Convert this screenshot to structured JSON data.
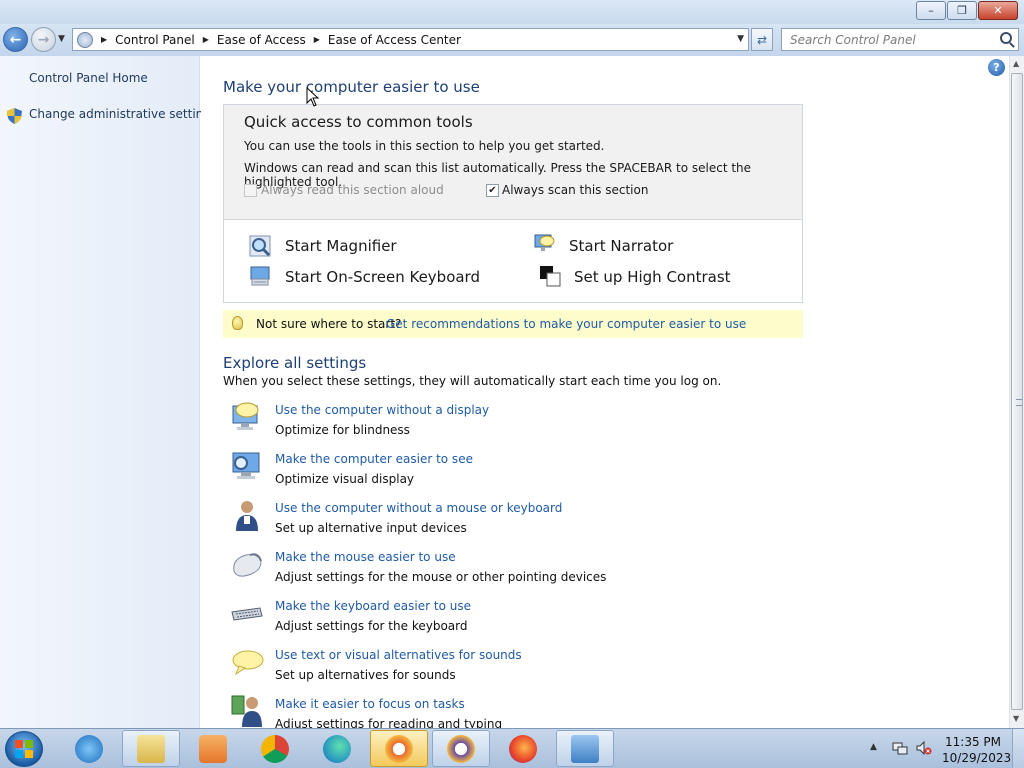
{
  "window": {
    "controls": {
      "minimize_icon": "minimize-icon",
      "maximize_icon": "restore-icon",
      "close_icon": "close-icon"
    }
  },
  "address_bar": {
    "breadcrumbs": [
      "Control Panel",
      "Ease of Access",
      "Ease of Access Center"
    ],
    "search_placeholder": "Search Control Panel"
  },
  "sidebar": {
    "items": [
      {
        "label": "Control Panel Home",
        "icon": ""
      },
      {
        "label": "Change administrative settings",
        "icon": "uac-shield-icon"
      }
    ]
  },
  "main": {
    "heading": "Make your computer easier to use",
    "quick_access": {
      "title": "Quick access to common tools",
      "line1": "You can use the tools in this section to help you get started.",
      "line2": "Windows can read and scan this list automatically.  Press the SPACEBAR to select the highlighted tool.",
      "read_aloud": {
        "label": "Always read this section aloud",
        "checked": false,
        "enabled": false
      },
      "scan": {
        "label": "Always scan this section",
        "checked": true,
        "enabled": true
      },
      "tools": [
        {
          "label": "Start Magnifier",
          "icon": "magnifier-icon"
        },
        {
          "label": "Start Narrator",
          "icon": "narrator-icon"
        },
        {
          "label": "Start On-Screen Keyboard",
          "icon": "onscreen-keyboard-icon"
        },
        {
          "label": "Set up High Contrast",
          "icon": "high-contrast-icon"
        }
      ]
    },
    "tip": {
      "prefix": "Not sure where to start?",
      "link": "Get recommendations to make your computer easier to use"
    },
    "explore": {
      "heading": "Explore all settings",
      "subtitle": "When you select these settings, they will automatically start each time you log on.",
      "items": [
        {
          "link": "Use the computer without a display",
          "desc": "Optimize for blindness",
          "icon": "display-speech-icon"
        },
        {
          "link": "Make the computer easier to see",
          "desc": "Optimize visual display",
          "icon": "monitor-magnify-icon"
        },
        {
          "link": "Use the computer without a mouse or keyboard",
          "desc": "Set up alternative input devices",
          "icon": "person-icon"
        },
        {
          "link": "Make the mouse easier to use",
          "desc": "Adjust settings for the mouse or other pointing devices",
          "icon": "mouse-icon"
        },
        {
          "link": "Make the keyboard easier to use",
          "desc": "Adjust settings for the keyboard",
          "icon": "keyboard-icon"
        },
        {
          "link": "Use text or visual alternatives for sounds",
          "desc": "Set up alternatives for sounds",
          "icon": "speech-bubble-icon"
        },
        {
          "link": "Make it easier to focus on tasks",
          "desc": "Adjust settings for reading and typing",
          "icon": "focus-tasks-icon"
        }
      ]
    }
  },
  "taskbar": {
    "apps": [
      {
        "name": "internet-explorer-icon",
        "state": "pinned"
      },
      {
        "name": "file-explorer-icon",
        "state": "open"
      },
      {
        "name": "media-player-icon",
        "state": "pinned"
      },
      {
        "name": "chrome-icon",
        "state": "pinned"
      },
      {
        "name": "edge-icon",
        "state": "pinned"
      },
      {
        "name": "app-yellow-icon",
        "state": "active"
      },
      {
        "name": "app-yellow-2-icon",
        "state": "open"
      },
      {
        "name": "firefox-icon",
        "state": "pinned"
      },
      {
        "name": "control-panel-icon",
        "state": "open"
      }
    ],
    "clock": {
      "time": "11:35 PM",
      "date": "10/29/2023"
    }
  },
  "colors": {
    "link": "#1f5aa6",
    "heading": "#1e3f73",
    "tip_bg": "#fdfdcc"
  }
}
